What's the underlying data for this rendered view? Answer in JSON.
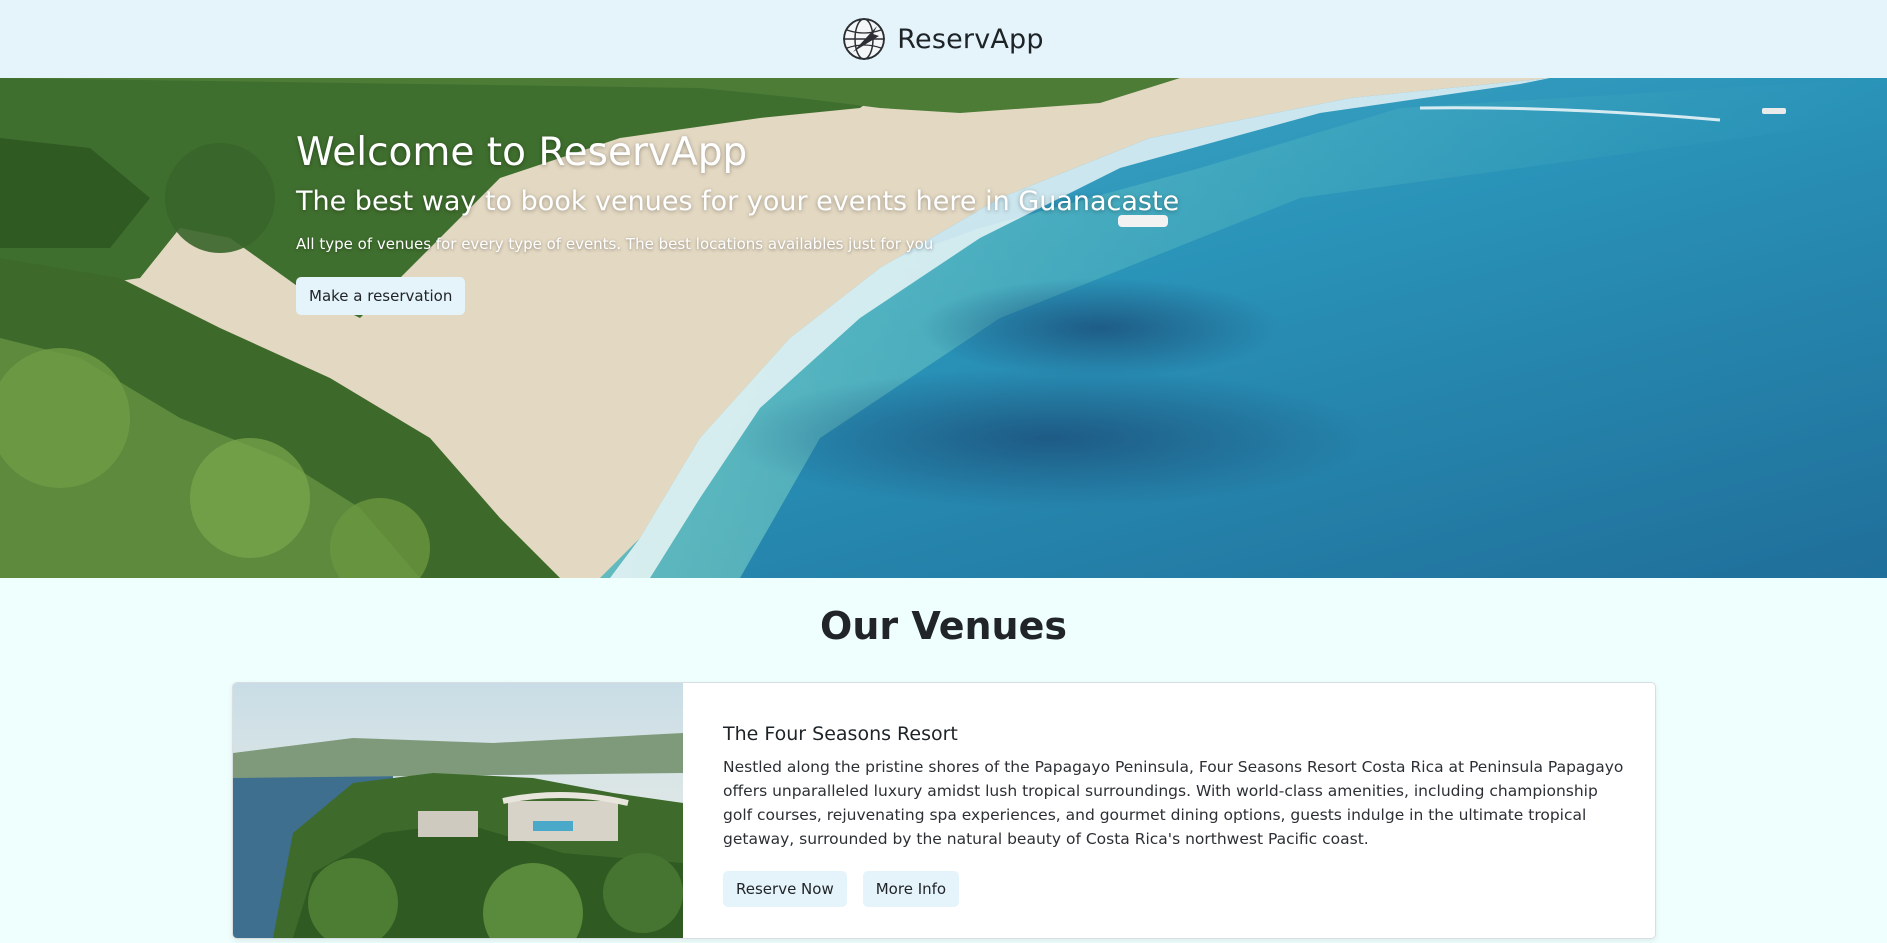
{
  "navbar": {
    "brand": "ReservApp",
    "logo_icon": "globe-plane-logo-icon"
  },
  "hero": {
    "title": "Welcome to ReservApp",
    "subtitle": "The best way to book venues for your events here in Guanacaste",
    "text": "All type of venues for every type of events. The best locations availables just for you",
    "button_label": "Make a reservation",
    "image": "beach-coast-photo"
  },
  "venues": {
    "heading": "Our Venues",
    "items": [
      {
        "name": "The Four Seasons Resort",
        "description": "Nestled along the pristine shores of the Papagayo Peninsula, Four Seasons Resort Costa Rica at Peninsula Papagayo offers unparalleled luxury amidst lush tropical surroundings. With world-class amenities, including championship golf courses, rejuvenating spa experiences, and gourmet dining options, guests indulge in the ultimate tropical getaway, surrounded by the natural beauty of Costa Rica's northwest Pacific coast.",
        "reserve_label": "Reserve Now",
        "info_label": "More Info",
        "image": "resort-aerial-photo"
      }
    ]
  },
  "colors": {
    "navbar_bg": "#e4f4fa",
    "page_bg": "#effffd",
    "button_bg": "#e4f4fa"
  }
}
